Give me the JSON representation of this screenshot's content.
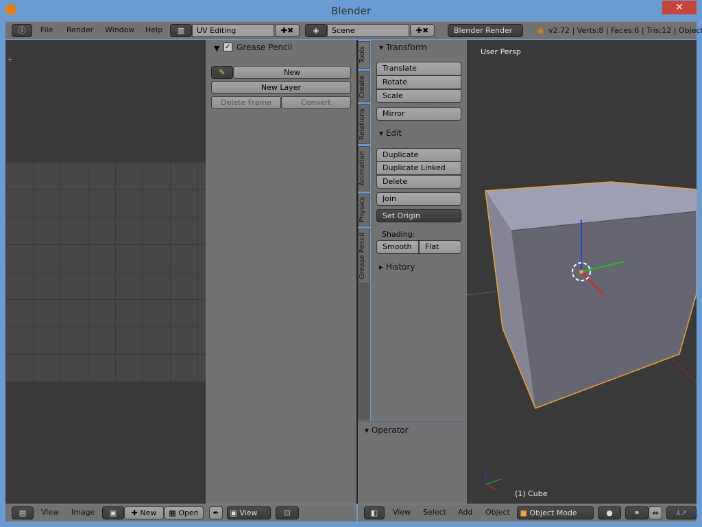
{
  "window": {
    "title": "Blender",
    "close": "✕"
  },
  "topbar": {
    "menus": [
      "File",
      "Render",
      "Window",
      "Help"
    ],
    "layout": "UV Editing",
    "scene": "Scene",
    "engine": "Blender Render",
    "stats": "v2.72 | Verts:8 | Faces:6 | Tris:12 | Object"
  },
  "grease": {
    "title": "Grease Pencil",
    "new": "New",
    "new_layer": "New Layer",
    "delete_frame": "Delete Frame",
    "convert": "Convert"
  },
  "tabs": [
    "Tools",
    "Create",
    "Relations",
    "Animation",
    "Physics",
    "Grease Pencil"
  ],
  "tools": {
    "transform": "Transform",
    "translate": "Translate",
    "rotate": "Rotate",
    "scale": "Scale",
    "mirror": "Mirror",
    "edit": "Edit",
    "duplicate": "Duplicate",
    "duplicate_linked": "Duplicate Linked",
    "delete": "Delete",
    "join": "Join",
    "set_origin": "Set Origin",
    "shading": "Shading:",
    "smooth": "Smooth",
    "flat": "Flat",
    "history": "History",
    "operator": "Operator"
  },
  "viewport": {
    "label": "User Persp",
    "object": "(1) Cube"
  },
  "bottom_left": {
    "view": "View",
    "image": "Image",
    "new": "New",
    "open": "Open",
    "view2": "View"
  },
  "bottom_right": {
    "view": "View",
    "select": "Select",
    "add": "Add",
    "object": "Object",
    "mode": "Object Mode"
  }
}
